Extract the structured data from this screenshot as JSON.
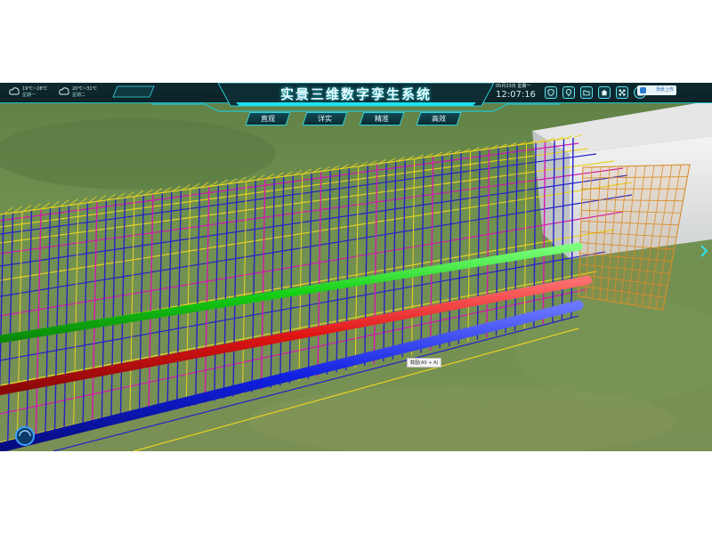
{
  "app": {
    "title": "实景三维数字孪生系统"
  },
  "weather": [
    {
      "temp": "19℃~28℃",
      "day": "星期一",
      "icon": "cloud-icon"
    },
    {
      "temp": "20℃~31℃",
      "day": "星期二",
      "icon": "cloud-icon"
    }
  ],
  "tabs": [
    {
      "label": "直观"
    },
    {
      "label": "详实"
    },
    {
      "label": "精准"
    },
    {
      "label": "高效"
    }
  ],
  "datetime": {
    "date": "05月23日  星期一",
    "time": "12:07:16"
  },
  "toolbar": {
    "icons": [
      "shield-icon",
      "location-pin-icon",
      "folder-icon",
      "home-icon",
      "fullscreen-icon",
      "user-icon"
    ],
    "upload_label": "场景上传"
  },
  "tooltip": {
    "text": "截图(Alt + A)"
  },
  "colors": {
    "accent": "#1bb9c8",
    "bar_dark": "#0b2228",
    "ground": "#6f8f4e",
    "rebar_blue": "#2323c8",
    "rebar_yellow": "#e8d321",
    "rebar_magenta": "#d418b0",
    "rebar_orange": "#e08a2a",
    "pipe_green": "#17d317",
    "pipe_red": "#e01818",
    "pipe_blue": "#1020e0"
  }
}
